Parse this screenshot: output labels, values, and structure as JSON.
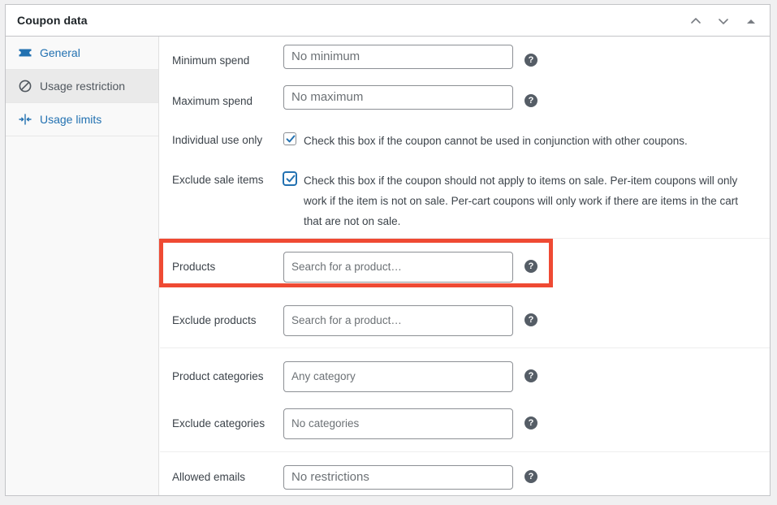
{
  "panel": {
    "title": "Coupon data",
    "header_buttons": [
      {
        "name": "move-up-button",
        "icon": "chevron-up-icon",
        "label": "Move up"
      },
      {
        "name": "move-down-button",
        "icon": "chevron-down-icon",
        "label": "Move down"
      },
      {
        "name": "toggle-panel-button",
        "icon": "triangle-up-icon",
        "label": "Toggle panel"
      }
    ]
  },
  "sidebar": {
    "items": [
      {
        "label": "General",
        "icon": "ticket-icon",
        "active": false
      },
      {
        "label": "Usage restriction",
        "icon": "no-entry-icon",
        "active": true
      },
      {
        "label": "Usage limits",
        "icon": "usage-limits-icon",
        "active": false
      }
    ]
  },
  "fields": {
    "minimum_spend": {
      "label": "Minimum spend",
      "placeholder": "No minimum",
      "value": "",
      "help": "?"
    },
    "maximum_spend": {
      "label": "Maximum spend",
      "placeholder": "No maximum",
      "value": "",
      "help": "?"
    },
    "individual_use": {
      "label": "Individual use only",
      "checkbox_text": "Check this box if the coupon cannot be used in conjunction with other coupons.",
      "checked": true
    },
    "exclude_sale_items": {
      "label": "Exclude sale items",
      "checkbox_text": "Check this box if the coupon should not apply to items on sale. Per-item coupons will only work if the item is not on sale. Per-cart coupons will only work if there are items in the cart that are not on sale.",
      "checked": true
    },
    "products": {
      "label": "Products",
      "placeholder": "Search for a product…",
      "help": "?"
    },
    "exclude_products": {
      "label": "Exclude products",
      "placeholder": "Search for a product…",
      "help": "?"
    },
    "product_categories": {
      "label": "Product categories",
      "placeholder": "Any category",
      "help": "?"
    },
    "exclude_categories": {
      "label": "Exclude categories",
      "placeholder": "No categories",
      "help": "?"
    },
    "allowed_emails": {
      "label": "Allowed emails",
      "placeholder": "No restrictions",
      "value": "",
      "help": "?"
    }
  },
  "highlight": {
    "target": "products-row",
    "color": "#ef4a33"
  },
  "colors": {
    "link": "#2271b1",
    "accent": "#2271b1",
    "highlight": "#ef4a33",
    "panel_border": "#c3c4c7",
    "page_bg": "#f0f0f1"
  }
}
